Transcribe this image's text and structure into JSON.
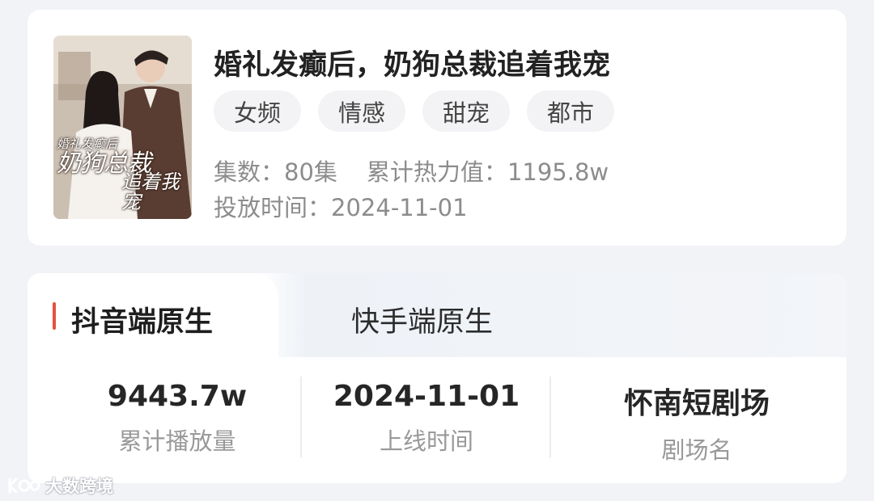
{
  "drama": {
    "title": "婚礼发癫后，奶狗总裁追着我宠",
    "poster": {
      "overlay_line1": "婚礼发癫后",
      "overlay_line2": "奶狗总裁",
      "overlay_line3": "追着我宠"
    },
    "tags": [
      "女频",
      "情感",
      "甜宠",
      "都市"
    ],
    "episodes_label": "集数：",
    "episodes_value": "80集",
    "heat_label": "累计热力值：",
    "heat_value": "1195.8w",
    "release_label": "投放时间：",
    "release_value": "2024-11-01"
  },
  "tabs": {
    "active": "抖音端原生",
    "inactive": "快手端原生"
  },
  "stats": [
    {
      "value": "9443.7w",
      "label": "累计播放量"
    },
    {
      "value": "2024-11-01",
      "label": "上线时间"
    },
    {
      "value": "怀南短剧场",
      "label": "剧场名"
    }
  ],
  "watermark": {
    "text": "大数跨境",
    "icon": "dashuju-logo-icon"
  },
  "colors": {
    "accent": "#e5533d",
    "page_bg": "#f1f3f6",
    "card_bg": "#ffffff"
  }
}
